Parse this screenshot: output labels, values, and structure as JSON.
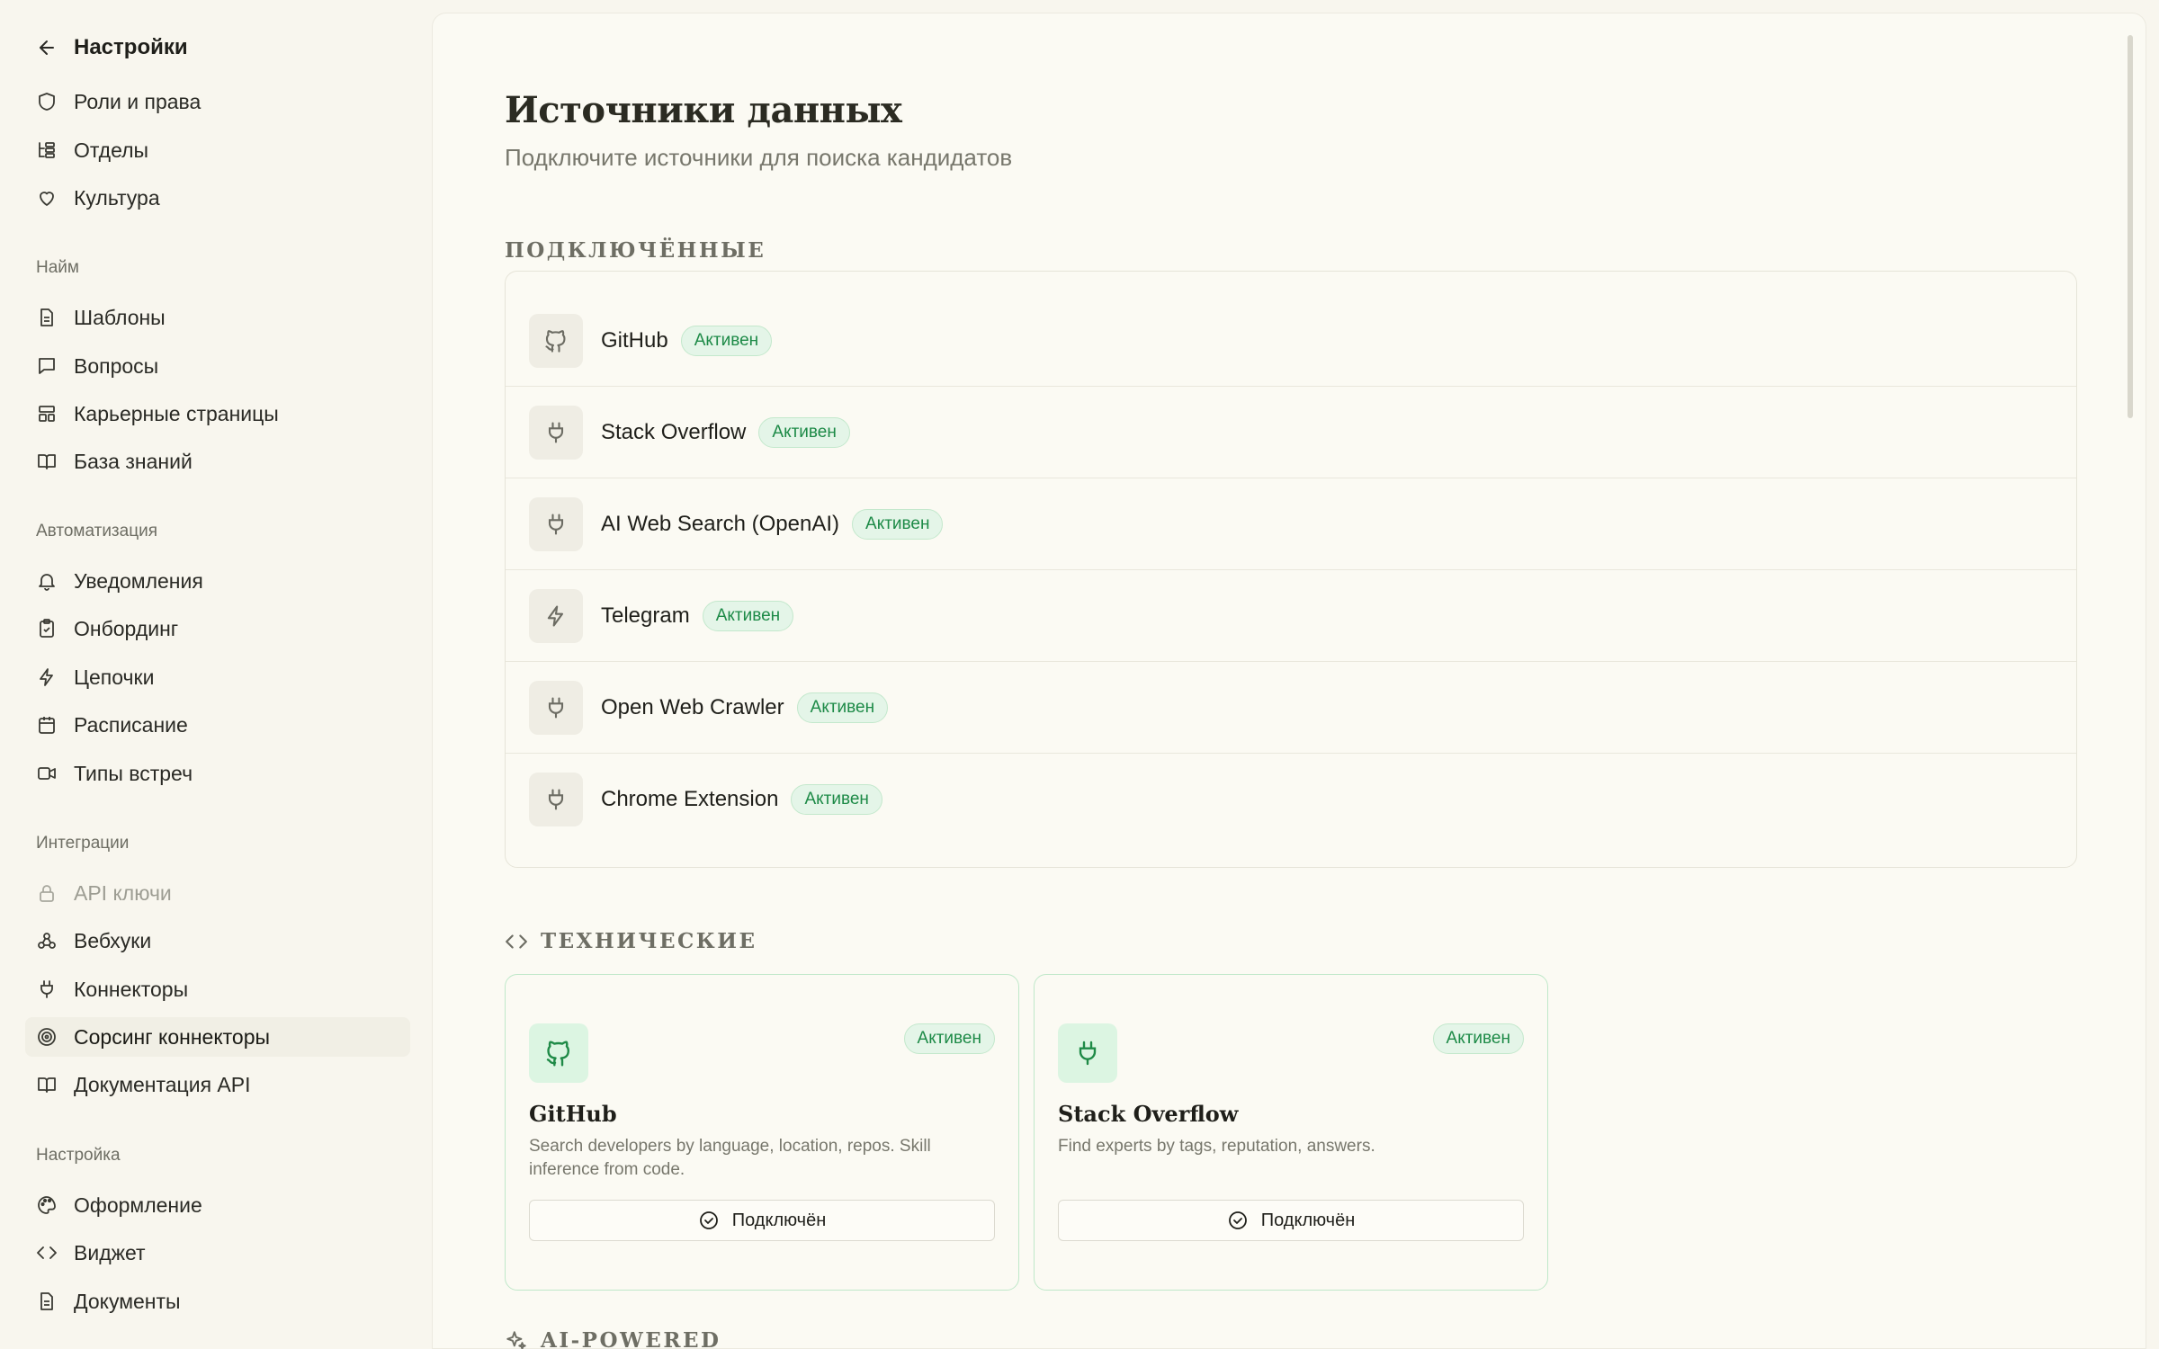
{
  "sidebar": {
    "header": "Настройки",
    "group1": [
      "Роли и права",
      "Отделы",
      "Культура"
    ],
    "sections": {
      "hiring": "Найм",
      "automation": "Автоматизация",
      "integrations": "Интеграции",
      "setup": "Настройка"
    },
    "hiring": [
      "Шаблоны",
      "Вопросы",
      "Карьерные страницы",
      "База знаний"
    ],
    "automation": [
      "Уведомления",
      "Онбординг",
      "Цепочки",
      "Расписание",
      "Типы встреч"
    ],
    "integrations": [
      "API ключи",
      "Вебхуки",
      "Коннекторы",
      "Сорсинг коннекторы",
      "Документация API"
    ],
    "setup": [
      "Оформление",
      "Виджет",
      "Документы"
    ]
  },
  "main": {
    "title": "Источники данных",
    "subtitle": "Подключите источники для поиска кандидатов",
    "connected_title": "ПОДКЛЮЧЁННЫЕ",
    "connected": [
      {
        "name": "GitHub",
        "status": "Активен"
      },
      {
        "name": "Stack Overflow",
        "status": "Активен"
      },
      {
        "name": "AI Web Search (OpenAI)",
        "status": "Активен"
      },
      {
        "name": "Telegram",
        "status": "Активен"
      },
      {
        "name": "Open Web Crawler",
        "status": "Активен"
      },
      {
        "name": "Chrome Extension",
        "status": "Активен"
      }
    ],
    "technical_title": "ТЕХНИЧЕСКИЕ",
    "cards": [
      {
        "name": "GitHub",
        "status": "Активен",
        "description": "Search developers by language, location, repos. Skill inference from code.",
        "button": "Подключён"
      },
      {
        "name": "Stack Overflow",
        "status": "Активен",
        "description": "Find experts by tags, reputation, answers.",
        "button": "Подключён"
      }
    ],
    "ai_title": "AI-POWERED"
  },
  "colors": {
    "background": "#f8f6ee",
    "panel": "#fbfaf3",
    "badge_bg": "#e4f5e8",
    "badge_text": "#1d8a47",
    "card_border": "#bfe8c9"
  }
}
